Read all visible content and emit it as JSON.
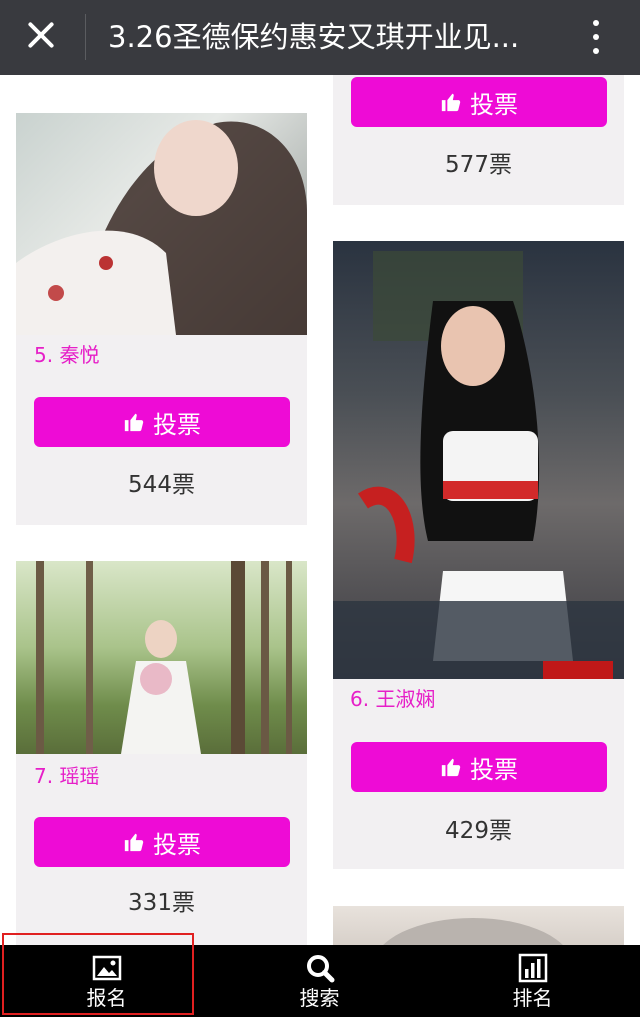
{
  "header": {
    "title": "3.26圣德保约惠安又琪开业见...",
    "close_icon": "close-icon",
    "more_icon": "more-vertical-icon"
  },
  "vote_label": "投票",
  "cards": [
    {
      "rank_name": "",
      "votes": "577票"
    },
    {
      "rank_name": "5. 秦悦",
      "votes": "544票"
    },
    {
      "rank_name": "6. 王淑娴",
      "votes": "429票"
    },
    {
      "rank_name": "7. 瑶瑶",
      "votes": "331票"
    }
  ],
  "colors": {
    "accent": "#ee0bd6",
    "name_text": "#e61fc8",
    "card_bg": "#f2f0f2",
    "topbar": "#393a3f",
    "bottomnav": "#000000",
    "highlight": "#e02020"
  },
  "bottom_nav": [
    {
      "label": "报名",
      "icon": "image-icon"
    },
    {
      "label": "搜索",
      "icon": "search-icon"
    },
    {
      "label": "排名",
      "icon": "bar-chart-icon"
    }
  ]
}
